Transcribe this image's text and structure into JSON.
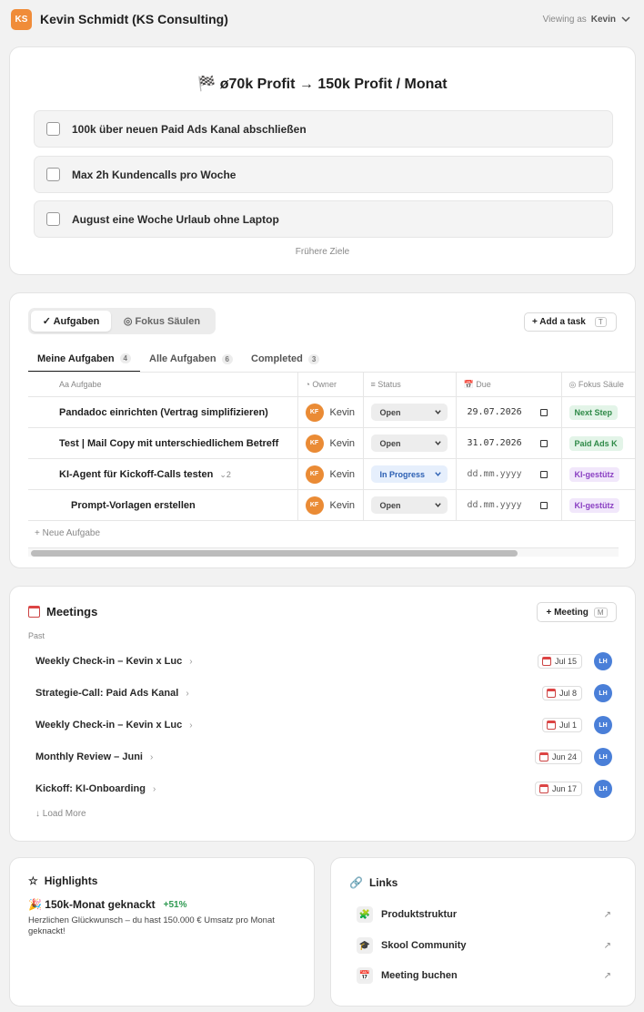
{
  "header": {
    "initials": "KS",
    "title": "Kevin Schmidt (KS Consulting)",
    "viewing_label": "Viewing as",
    "viewing_user": "Kevin"
  },
  "goals": {
    "title": "🏁 ø70k Profit → 150k Profit / Monat",
    "items": [
      "100k über neuen Paid Ads Kanal abschließen",
      "Max 2h Kundencalls pro Woche",
      "August eine Woche Urlaub ohne Laptop"
    ],
    "earlier_label": "Frühere Ziele"
  },
  "tasks": {
    "segments": [
      "✓ Aufgaben",
      "◎ Fokus Säulen"
    ],
    "add_label": "+ Add a task",
    "add_shortcut": "T",
    "tabs": [
      {
        "label": "Meine Aufgaben",
        "count": "4"
      },
      {
        "label": "Alle Aufgaben",
        "count": "6"
      },
      {
        "label": "Completed",
        "count": "3"
      }
    ],
    "columns": [
      "Aa Aufgabe",
      "◔ Owner",
      "≡ Status",
      "📅 Due",
      "◎ Fokus Säule"
    ],
    "rows": [
      {
        "task": "Pandadoc einrichten (Vertrag simplifizieren)",
        "owner_initials": "KF",
        "owner": "Kevin",
        "status": "Open",
        "due": "29.07.2026",
        "focus": "Next Step"
      },
      {
        "task": "Test | Mail Copy mit unterschiedlichem Betreff",
        "owner_initials": "KF",
        "owner": "Kevin",
        "status": "Open",
        "due": "31.07.2026",
        "focus": "Paid Ads K"
      },
      {
        "task": "KI-Agent für Kickoff-Calls testen",
        "subcount": "⌄2",
        "owner_initials": "KF",
        "owner": "Kevin",
        "status": "In Progress",
        "due": "dd.mm.yyyy",
        "focus": "KI-gestütz"
      },
      {
        "task": "Prompt-Vorlagen erstellen",
        "owner_initials": "KF",
        "owner": "Kevin",
        "status": "Open",
        "due": "dd.mm.yyyy",
        "focus": "KI-gestütz"
      }
    ],
    "new_task_label": "+ Neue Aufgabe"
  },
  "meetings": {
    "title": "Meetings",
    "add_label": "+ Meeting",
    "add_shortcut": "M",
    "section_label": "Past",
    "items": [
      {
        "name": "Weekly Check-in – Kevin x Luc",
        "date": "Jul 15",
        "attendee": "LH"
      },
      {
        "name": "Strategie-Call: Paid Ads Kanal",
        "date": "Jul 8",
        "attendee": "LH"
      },
      {
        "name": "Weekly Check-in – Kevin x Luc",
        "date": "Jul 1",
        "attendee": "LH"
      },
      {
        "name": "Monthly Review – Juni",
        "date": "Jun 24",
        "attendee": "LH"
      },
      {
        "name": "Kickoff: KI-Onboarding",
        "date": "Jun 17",
        "attendee": "LH"
      }
    ],
    "load_more_label": "↓ Load More"
  },
  "highlights": {
    "title": "Highlights",
    "headline": "🎉 150k-Monat geknackt",
    "delta": "+51%",
    "text": "Herzlichen Glückwunsch – du hast 150.000 € Umsatz pro Monat geknackt!"
  },
  "links": {
    "title": "Links",
    "items": [
      {
        "icon": "🧩",
        "label": "Produktstruktur"
      },
      {
        "icon": "🎓",
        "label": "Skool Community"
      },
      {
        "icon": "📅",
        "label": "Meeting buchen"
      }
    ]
  },
  "colors": {
    "accent_orange": "#f08c39",
    "owner_avatar": "#ea8b35",
    "meeting_avatar": "#4a7fd8",
    "tag_green": "#2f8a48",
    "tag_purple": "#8a3fc2",
    "in_progress": "#2b5fb3"
  }
}
